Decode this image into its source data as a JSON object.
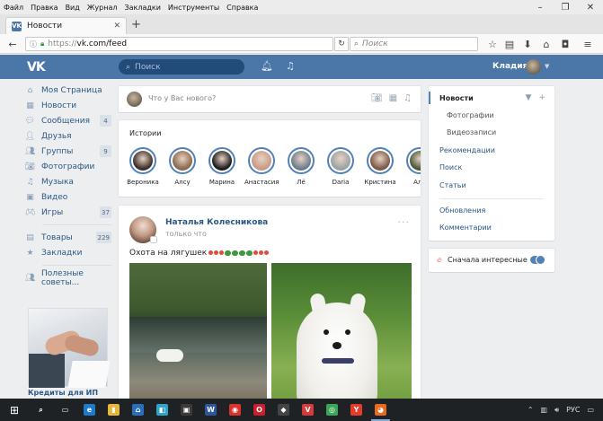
{
  "browser": {
    "menu": [
      "Файл",
      "Правка",
      "Вид",
      "Журнал",
      "Закладки",
      "Инструменты",
      "Справка"
    ],
    "window_controls": [
      "–",
      "❐",
      "✕"
    ],
    "tab": {
      "title": "Новости",
      "favicon": "VK",
      "close": "✕"
    },
    "newtab": "+",
    "url_proto": "https://",
    "url_host": "vk.com/feed",
    "search_placeholder": "Поиск",
    "icons": [
      "star-icon",
      "clipboard-icon",
      "download-icon",
      "home-icon",
      "pocket-icon",
      "menu-icon"
    ]
  },
  "vk": {
    "logo": "VK",
    "search_placeholder": "Поиск",
    "user_name": "Кладия",
    "accent": "#4a76a8"
  },
  "left_menu": [
    {
      "label": "Моя Страница",
      "icon": "home-icon",
      "count": ""
    },
    {
      "label": "Новости",
      "icon": "news-icon",
      "count": ""
    },
    {
      "label": "Сообщения",
      "icon": "message-icon",
      "count": "4"
    },
    {
      "label": "Друзья",
      "icon": "user-icon",
      "count": ""
    },
    {
      "label": "Группы",
      "icon": "group-icon",
      "count": "9"
    },
    {
      "label": "Фотографии",
      "icon": "camera-icon",
      "count": ""
    },
    {
      "label": "Музыка",
      "icon": "music-icon",
      "count": ""
    },
    {
      "label": "Видео",
      "icon": "video-icon",
      "count": ""
    },
    {
      "label": "Игры",
      "icon": "gamepad-icon",
      "count": "37"
    }
  ],
  "left_menu_2": [
    {
      "label": "Товары",
      "icon": "shop-icon",
      "count": "229"
    },
    {
      "label": "Закладки",
      "icon": "star-icon",
      "count": ""
    }
  ],
  "left_menu_3": [
    {
      "label": "Полезные советы...",
      "icon": "group-icon",
      "count": ""
    }
  ],
  "ad_caption": "Кредиты для ИП",
  "composer": {
    "placeholder": "Что у Вас нового?"
  },
  "stories": {
    "title": "Истории",
    "items": [
      {
        "name": "Вероника",
        "color": "#3a2f2a"
      },
      {
        "name": "Алсу",
        "color": "#8a6a50"
      },
      {
        "name": "Марина",
        "color": "#1c1c1c"
      },
      {
        "name": "Анастасия",
        "color": "#c79b86"
      },
      {
        "name": "Лё",
        "color": "#6b7d8c"
      },
      {
        "name": "Daria",
        "color": "#9aa2a6"
      },
      {
        "name": "Кристина",
        "color": "#7a5a48"
      },
      {
        "name": "Али",
        "color": "#4a5a3a"
      }
    ]
  },
  "post": {
    "author": "Наталья Колесникова",
    "time": "только что",
    "text": "Охота на лягушек"
  },
  "right_nav": {
    "active": "Новости",
    "sub": [
      "Фотографии",
      "Видеозаписи"
    ],
    "items": [
      "Рекомендации",
      "Поиск",
      "Статьи"
    ],
    "items2": [
      "Обновления",
      "Комментарии"
    ]
  },
  "interest": {
    "label": "Сначала интересные",
    "enabled": true
  },
  "taskbar": {
    "apps": [
      {
        "name": "search-icon",
        "color": "transparent",
        "glyph": "⌕"
      },
      {
        "name": "taskview-icon",
        "color": "transparent",
        "glyph": "▭"
      },
      {
        "name": "edge-icon",
        "color": "#1f7acc",
        "glyph": "e"
      },
      {
        "name": "files-icon",
        "color": "#e5b73b",
        "glyph": "▮"
      },
      {
        "name": "store-icon",
        "color": "#2a6ebb",
        "glyph": "⌂"
      },
      {
        "name": "media-icon",
        "color": "#2fa3c8",
        "glyph": "◧"
      },
      {
        "name": "photo-icon",
        "color": "#3a3a3a",
        "glyph": "▣"
      },
      {
        "name": "word-icon",
        "color": "#2b579a",
        "glyph": "W"
      },
      {
        "name": "app-red-icon",
        "color": "#d9342b",
        "glyph": "◉"
      },
      {
        "name": "opera-icon",
        "color": "#cc1f2d",
        "glyph": "O"
      },
      {
        "name": "app-dark-icon",
        "color": "#444",
        "glyph": "◆"
      },
      {
        "name": "vivaldi-icon",
        "color": "#d83a3a",
        "glyph": "V"
      },
      {
        "name": "chrome-icon",
        "color": "#3aa757",
        "glyph": "◎"
      },
      {
        "name": "yandex-icon",
        "color": "#e63a2a",
        "glyph": "Y"
      },
      {
        "name": "firefox-icon",
        "color": "#e66a1f",
        "glyph": "◕"
      }
    ],
    "lang": "РУС"
  }
}
